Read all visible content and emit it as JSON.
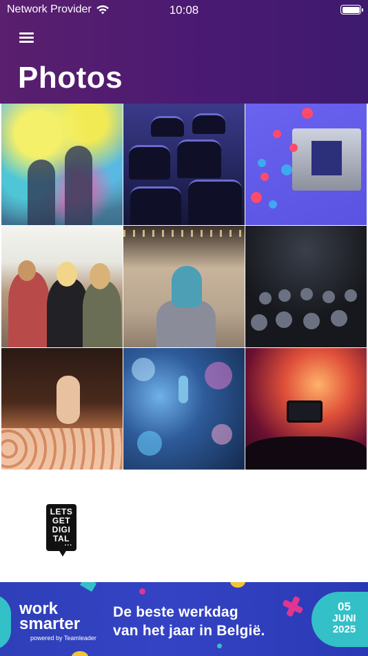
{
  "status_bar": {
    "carrier": "Network Provider",
    "time": "10:08",
    "icons": [
      "wifi-icon",
      "battery-icon"
    ]
  },
  "header": {
    "title": "Photos",
    "menu_icon": "hamburger-menu-icon",
    "gradient_colors": [
      "#5a1f6e",
      "#3e1a6e"
    ]
  },
  "gallery": {
    "columns": 3,
    "photos": [
      {
        "subject": "color-powder-festival"
      },
      {
        "subject": "empty-conference-chairs"
      },
      {
        "subject": "virtual-event-stage"
      },
      {
        "subject": "outdoor-festival-crowd"
      },
      {
        "subject": "speaker-blue-hair-audience"
      },
      {
        "subject": "dark-auditorium-audience"
      },
      {
        "subject": "concert-crowd-hands"
      },
      {
        "subject": "blue-stage-microphone"
      },
      {
        "subject": "concert-phone-recording"
      }
    ]
  },
  "logo": {
    "lines": [
      "LETS",
      "GET",
      "DIGI",
      "TAL"
    ],
    "dots": "..."
  },
  "banner": {
    "brand_line1": "work",
    "brand_line2": "smarter",
    "powered_by": "powered by Teamleader",
    "headline_line1": "De beste werkdag",
    "headline_line2": "van het jaar in België.",
    "date_day": "05",
    "date_month": "JUNI",
    "date_year": "2025",
    "colors": {
      "background": "#2f3fb8",
      "badge": "#33c0c7",
      "accent_pink": "#e0368f",
      "accent_yellow": "#f2c43a"
    }
  }
}
